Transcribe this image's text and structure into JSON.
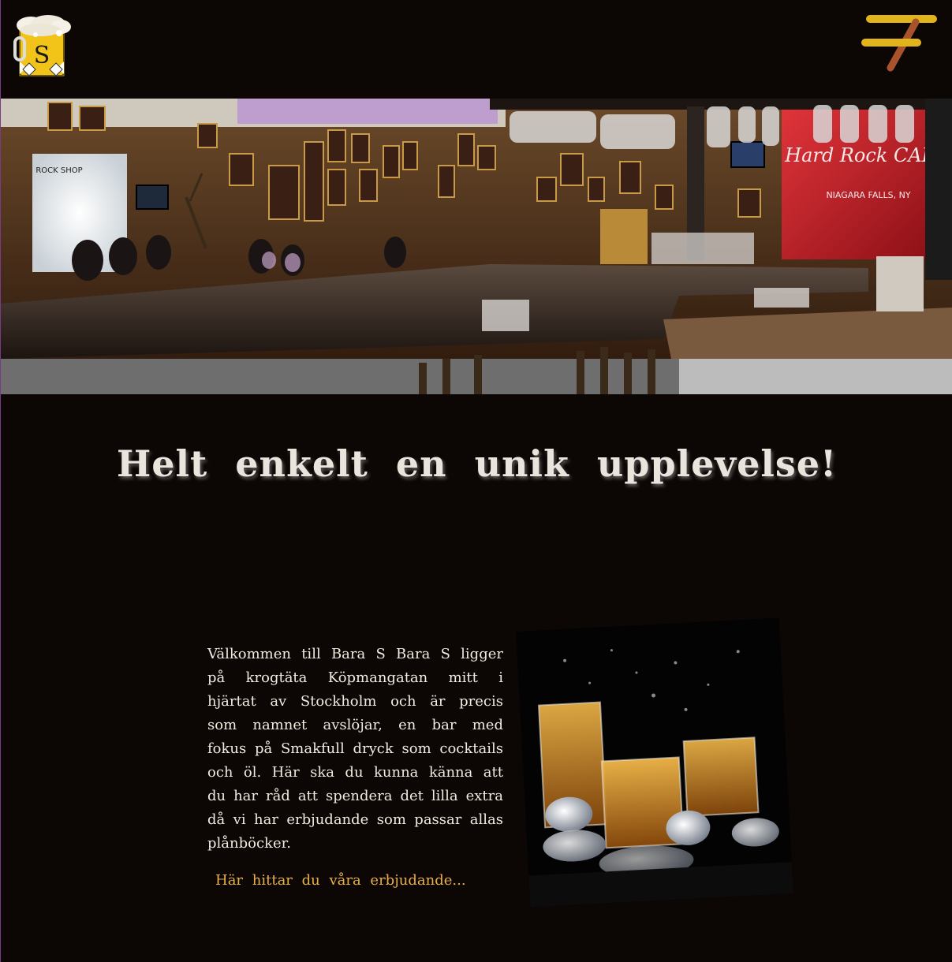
{
  "header": {
    "logo_letter": "S",
    "menu_icon": "hamburger-icon"
  },
  "hero": {
    "sign_brand": "Hard Rock CAFE",
    "sign_location": "NIAGARA FALLS, NY",
    "shop_sign": "ROCK SHOP"
  },
  "main": {
    "headline": "Helt enkelt en unik upplevelse!",
    "intro": "Välkommen till Bara S Bara S ligger på krogtäta Köpmangatan mitt i hjärtat av Stockholm och är precis som namnet avslöjar, en bar med fokus på Smakfull dryck som cocktails och öl. Här ska du kunna känna att du har råd att spendera det lilla extra då vi har erbjudande som passar allas plånböcker.",
    "offers_link": "Här hittar du våra erbjudande..."
  },
  "colors": {
    "background": "#0c0604",
    "accent": "#e8b04a",
    "menu_yellow": "#e0b41a",
    "logo_yellow": "#f2c318"
  }
}
